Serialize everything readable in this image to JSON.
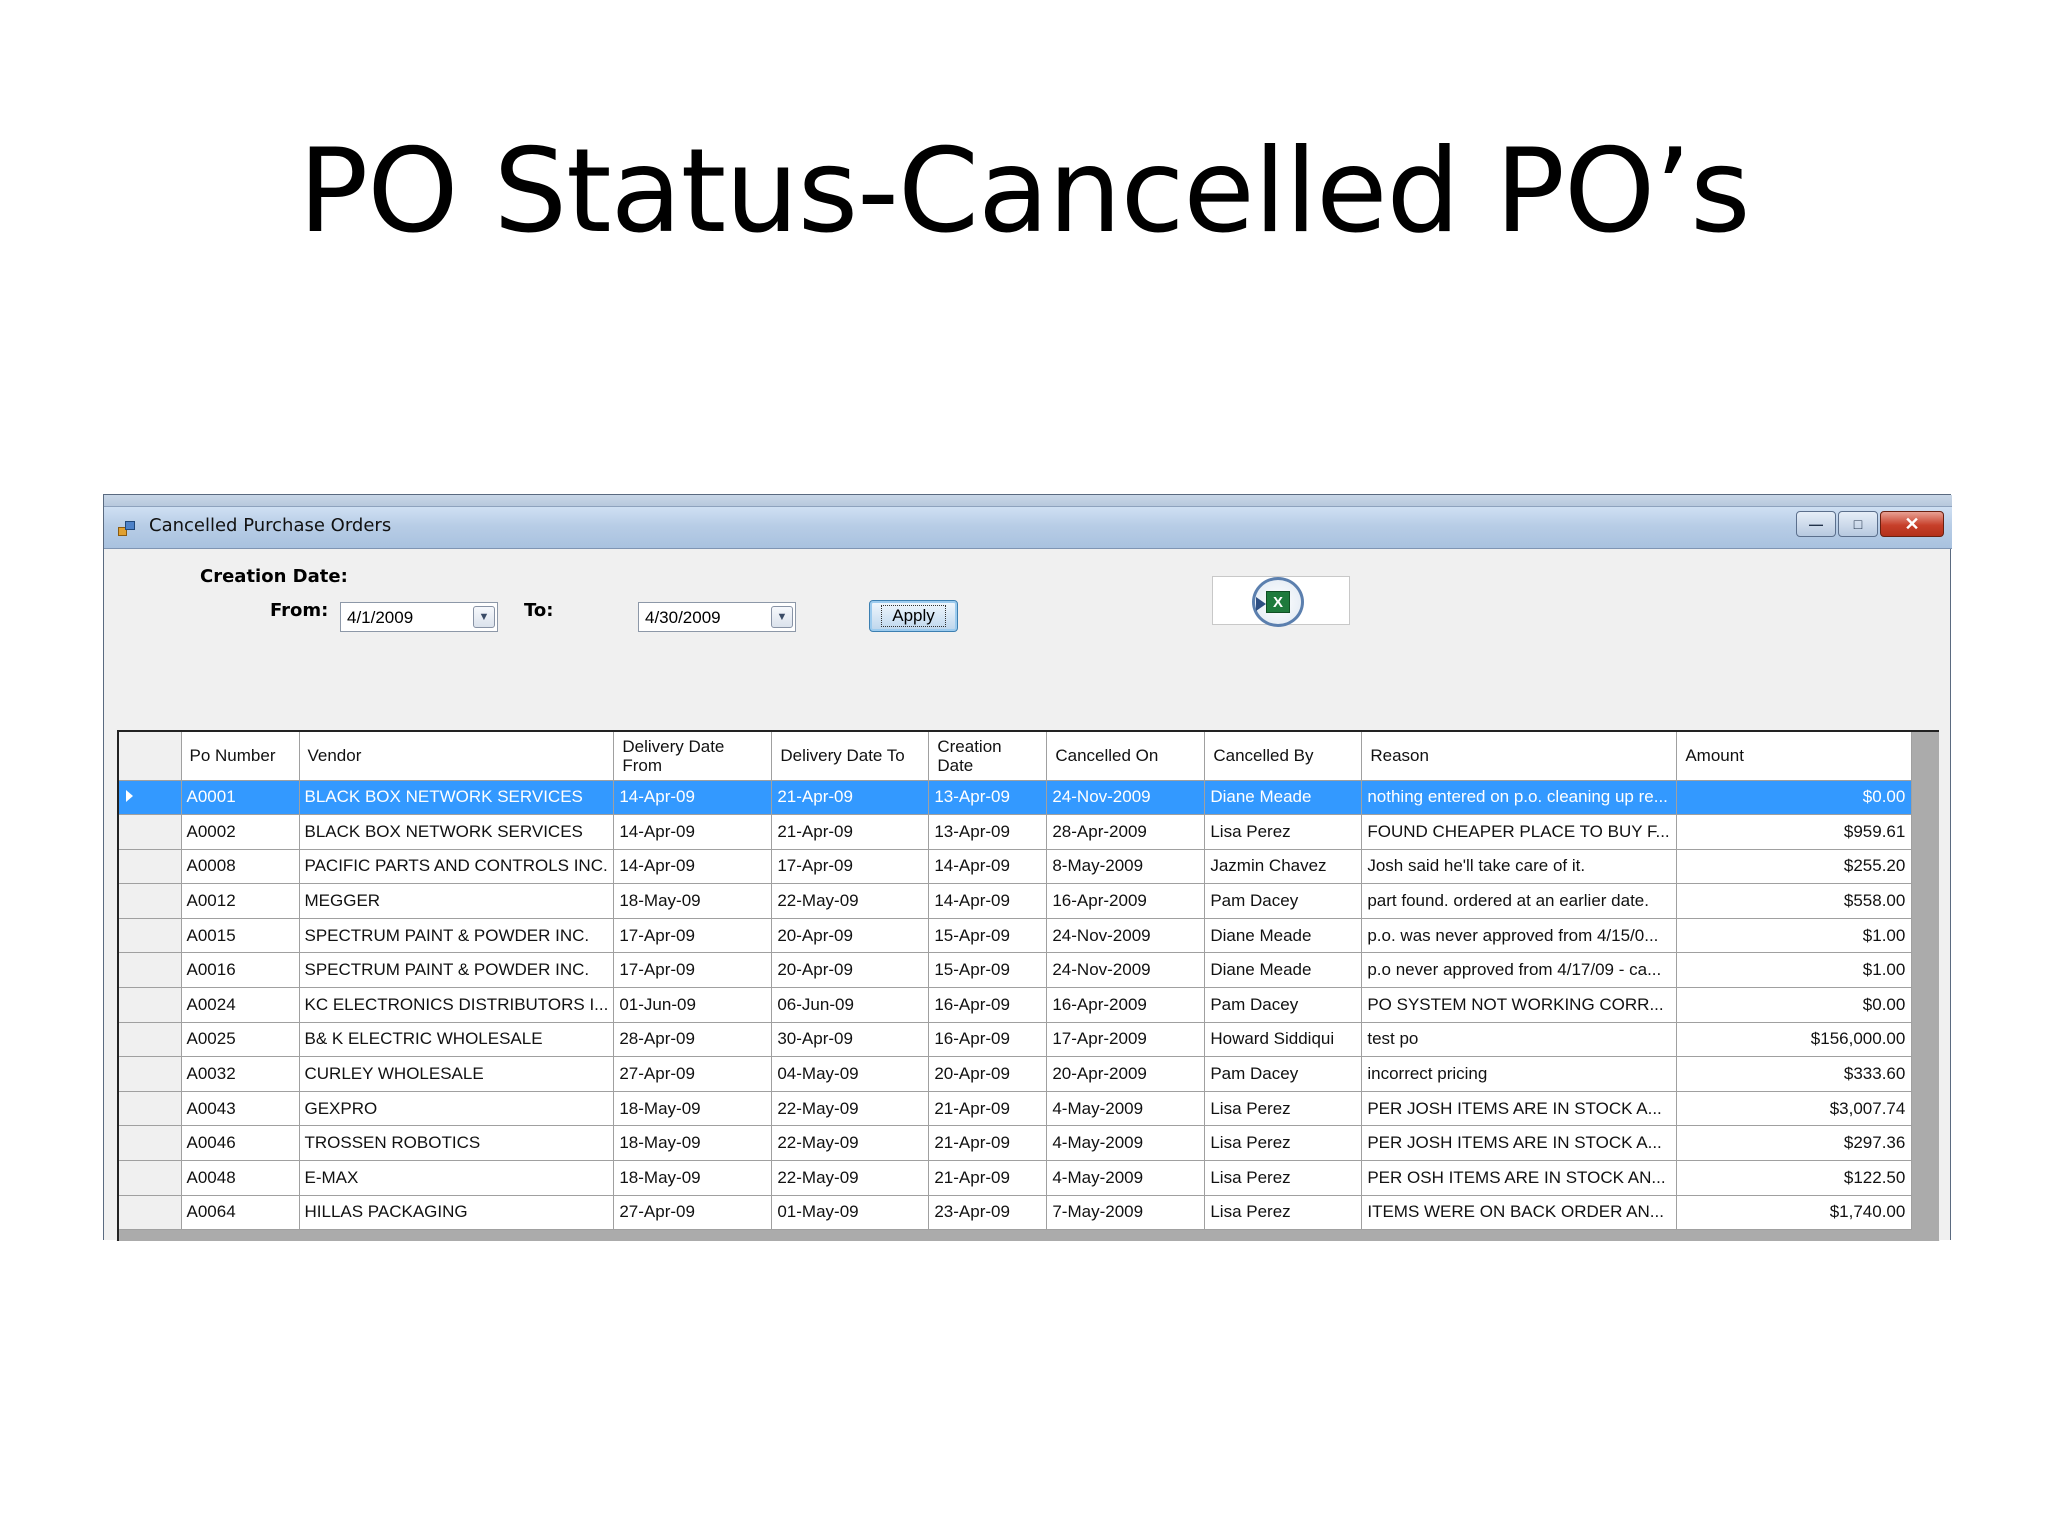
{
  "slide": {
    "title": "PO Status-Cancelled PO’s"
  },
  "window": {
    "title": "Cancelled Purchase Orders",
    "minimize": "—",
    "maximize": "□",
    "close": "✕"
  },
  "filters": {
    "section_label": "Creation Date:",
    "from_label": "From:",
    "from_value": "4/1/2009",
    "to_label": "To:",
    "to_value": "4/30/2009",
    "apply_label": "Apply",
    "dropdown_icon": "chevron-down-icon",
    "export_icon": "excel-export-icon"
  },
  "grid": {
    "columns": [
      "Po Number",
      "Vendor",
      "Delivery Date From",
      "Delivery Date To",
      "Creation Date",
      "Cancelled On",
      "Cancelled By",
      "Reason",
      "Amount"
    ],
    "rows": [
      {
        "po": "A0001",
        "vendor": "BLACK BOX NETWORK SERVICES",
        "from": "14-Apr-09",
        "to": "21-Apr-09",
        "created": "13-Apr-09",
        "cancelled_on": "24-Nov-2009",
        "cancelled_by": "Diane Meade",
        "reason": "nothing entered on p.o.  cleaning up re...",
        "amount": "$0.00",
        "selected": true
      },
      {
        "po": "A0002",
        "vendor": "BLACK BOX NETWORK SERVICES",
        "from": "14-Apr-09",
        "to": "21-Apr-09",
        "created": "13-Apr-09",
        "cancelled_on": "28-Apr-2009",
        "cancelled_by": "Lisa Perez",
        "reason": "FOUND CHEAPER PLACE TO BUY F...",
        "amount": "$959.61"
      },
      {
        "po": "A0008",
        "vendor": "PACIFIC PARTS AND CONTROLS INC.",
        "from": "14-Apr-09",
        "to": "17-Apr-09",
        "created": "14-Apr-09",
        "cancelled_on": "8-May-2009",
        "cancelled_by": "Jazmin Chavez",
        "reason": "Josh said he'll take care of it.",
        "amount": "$255.20"
      },
      {
        "po": "A0012",
        "vendor": "MEGGER",
        "from": "18-May-09",
        "to": "22-May-09",
        "created": "14-Apr-09",
        "cancelled_on": "16-Apr-2009",
        "cancelled_by": "Pam Dacey",
        "reason": "part found. ordered at an earlier date.",
        "amount": "$558.00"
      },
      {
        "po": "A0015",
        "vendor": "SPECTRUM PAINT & POWDER INC.",
        "from": "17-Apr-09",
        "to": "20-Apr-09",
        "created": "15-Apr-09",
        "cancelled_on": "24-Nov-2009",
        "cancelled_by": "Diane Meade",
        "reason": "p.o. was never approved from 4/15/0...",
        "amount": "$1.00"
      },
      {
        "po": "A0016",
        "vendor": "SPECTRUM PAINT & POWDER INC.",
        "from": "17-Apr-09",
        "to": "20-Apr-09",
        "created": "15-Apr-09",
        "cancelled_on": "24-Nov-2009",
        "cancelled_by": "Diane Meade",
        "reason": "p.o never approved from 4/17/09 - ca...",
        "amount": "$1.00"
      },
      {
        "po": "A0024",
        "vendor": "KC ELECTRONICS DISTRIBUTORS I...",
        "from": "01-Jun-09",
        "to": "06-Jun-09",
        "created": "16-Apr-09",
        "cancelled_on": "16-Apr-2009",
        "cancelled_by": "Pam Dacey",
        "reason": "PO SYSTEM NOT WORKING CORR...",
        "amount": "$0.00"
      },
      {
        "po": "A0025",
        "vendor": "B& K ELECTRIC WHOLESALE",
        "from": "28-Apr-09",
        "to": "30-Apr-09",
        "created": "16-Apr-09",
        "cancelled_on": "17-Apr-2009",
        "cancelled_by": "Howard Siddiqui",
        "reason": "test po",
        "amount": "$156,000.00"
      },
      {
        "po": "A0032",
        "vendor": "CURLEY WHOLESALE",
        "from": "27-Apr-09",
        "to": "04-May-09",
        "created": "20-Apr-09",
        "cancelled_on": "20-Apr-2009",
        "cancelled_by": "Pam Dacey",
        "reason": "incorrect pricing",
        "amount": "$333.60"
      },
      {
        "po": "A0043",
        "vendor": "GEXPRO",
        "from": "18-May-09",
        "to": "22-May-09",
        "created": "21-Apr-09",
        "cancelled_on": "4-May-2009",
        "cancelled_by": "Lisa Perez",
        "reason": "PER JOSH ITEMS ARE IN STOCK A...",
        "amount": "$3,007.74"
      },
      {
        "po": "A0046",
        "vendor": "TROSSEN ROBOTICS",
        "from": "18-May-09",
        "to": "22-May-09",
        "created": "21-Apr-09",
        "cancelled_on": "4-May-2009",
        "cancelled_by": "Lisa Perez",
        "reason": "PER JOSH ITEMS ARE IN STOCK A...",
        "amount": "$297.36"
      },
      {
        "po": "A0048",
        "vendor": "E-MAX",
        "from": "18-May-09",
        "to": "22-May-09",
        "created": "21-Apr-09",
        "cancelled_on": "4-May-2009",
        "cancelled_by": "Lisa Perez",
        "reason": "PER OSH ITEMS ARE IN STOCK AN...",
        "amount": "$122.50"
      },
      {
        "po": "A0064",
        "vendor": "HILLAS PACKAGING",
        "from": "27-Apr-09",
        "to": "01-May-09",
        "created": "23-Apr-09",
        "cancelled_on": "7-May-2009",
        "cancelled_by": "Lisa Perez",
        "reason": "ITEMS WERE ON BACK ORDER AN...",
        "amount": "$1,740.00"
      }
    ]
  },
  "colors": {
    "selection": "#3399ff",
    "titlebar": "#b8cde6",
    "close_button": "#c7402a"
  }
}
